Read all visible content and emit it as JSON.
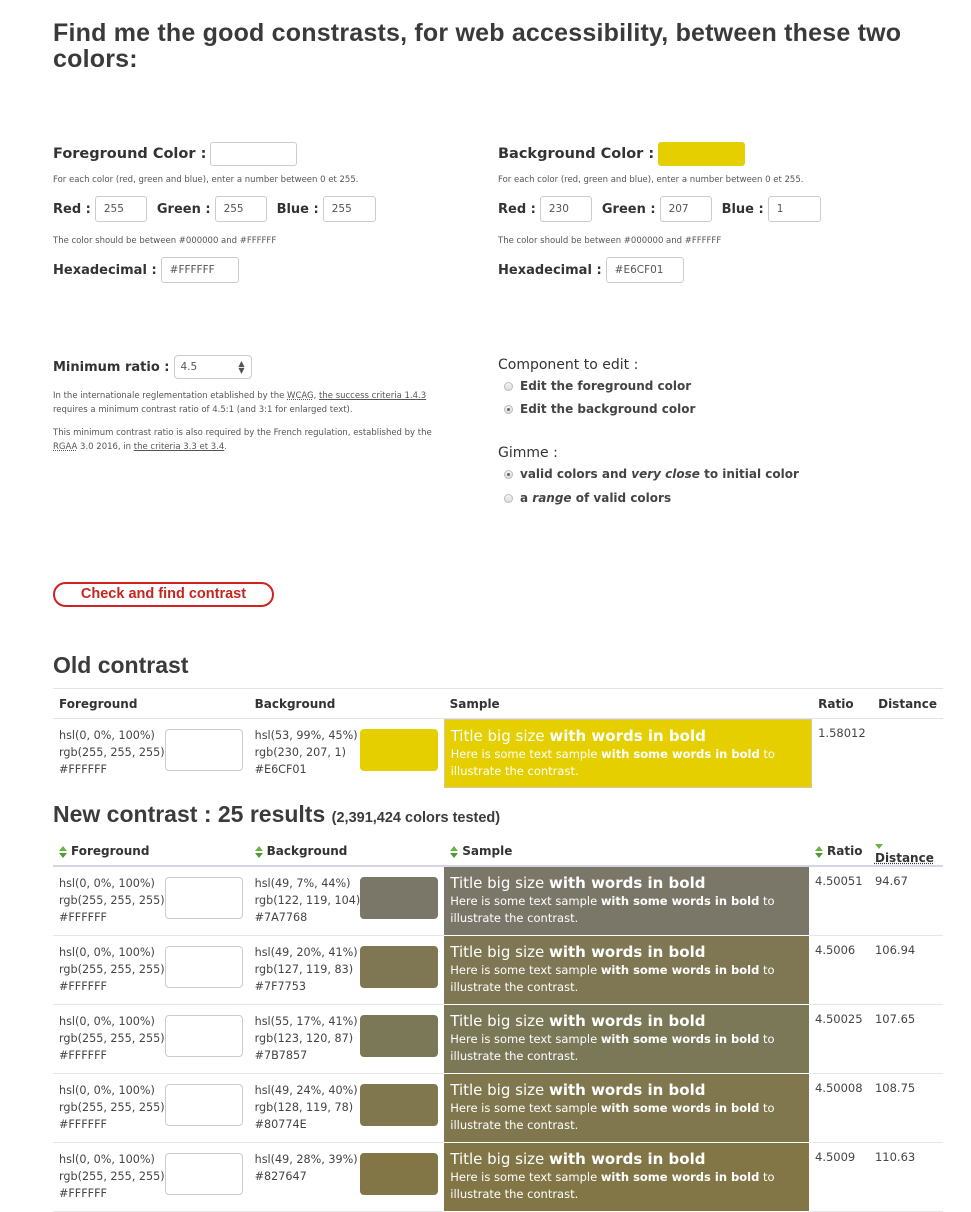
{
  "page": {
    "title": "Find me the good constrasts, for web accessibility, between these two colors:"
  },
  "foreground": {
    "label": "Foreground Color :",
    "preview_color": "#FFFFFF",
    "hint_rgb": "For each color (red, green and blue), enter a number between 0 et 255.",
    "red_label": "Red :",
    "red": "255",
    "green_label": "Green :",
    "green": "255",
    "blue_label": "Blue :",
    "blue": "255",
    "hint_hex": "The color should be between #000000 and #FFFFFF",
    "hex_label": "Hexadecimal :",
    "hex": "#FFFFFF"
  },
  "background": {
    "label": "Background Color :",
    "preview_color": "#E6CF01",
    "hint_rgb": "For each color (red, green and blue), enter a number between 0 et 255.",
    "red_label": "Red :",
    "red": "230",
    "green_label": "Green :",
    "green": "207",
    "blue_label": "Blue :",
    "blue": "1",
    "hint_hex": "The color should be between #000000 and #FFFFFF",
    "hex_label": "Hexadecimal :",
    "hex": "#E6CF01"
  },
  "ratio": {
    "label": "Minimum ratio :",
    "selected": "4.5",
    "para1_a": "In the internationale reglementation etablished by the ",
    "para1_abbr": "WCAG",
    "para1_b": ", ",
    "para1_link": "the success criteria 1.4.3",
    "para1_c": " requires a minimum contrast ratio of 4.5:1 (and 3:1 for enlarged text).",
    "para2_a": "This minimum contrast ratio is also required by the French regulation, established by the ",
    "para2_abbr": "RGAA",
    "para2_b": " 3.0 2016, in ",
    "para2_link": "the criteria 3.3 et 3.4",
    "para2_c": "."
  },
  "component": {
    "heading": "Component to edit :",
    "options": [
      {
        "label": "Edit the foreground color",
        "checked": false
      },
      {
        "label": "Edit the background color",
        "checked": true
      }
    ]
  },
  "gimme": {
    "heading": "Gimme :",
    "opt1_a": "valid colors and ",
    "opt1_em": "very close",
    "opt1_b": " to initial color",
    "opt1_checked": true,
    "opt2_a": "a ",
    "opt2_em": "range",
    "opt2_b": " of valid colors",
    "opt2_checked": false
  },
  "check_button": "Check and find contrast",
  "sample_text": {
    "title_a": "Title big size ",
    "title_b": "with words in bold",
    "body_a": "Here is some text sample ",
    "body_b": "with some words in bold",
    "body_c": " to illustrate the contrast."
  },
  "old_contrast": {
    "heading": "Old contrast",
    "columns": [
      "Foreground",
      "Background",
      "Sample",
      "Ratio",
      "Distance"
    ],
    "row": {
      "fg": {
        "hsl": "hsl(0, 0%, 100%)",
        "rgb": "rgb(255, 255, 255)",
        "hex": "#FFFFFF"
      },
      "bg": {
        "hsl": "hsl(53, 99%, 45%)",
        "rgb": "rgb(230, 207, 1)",
        "hex": "#E6CF01"
      },
      "ratio": "1.58012",
      "distance": ""
    }
  },
  "new_contrast": {
    "heading": "New contrast : 25 results",
    "subheading": "(2,391,424 colors tested)",
    "columns": [
      "Foreground",
      "Background",
      "Sample",
      "Ratio",
      "Distance"
    ],
    "sort_active": "Distance",
    "rows": [
      {
        "fg": {
          "hsl": "hsl(0, 0%, 100%)",
          "rgb": "rgb(255, 255, 255)",
          "hex": "#FFFFFF"
        },
        "bg": {
          "hsl": "hsl(49, 7%, 44%)",
          "rgb": "rgb(122, 119, 104)",
          "hex": "#7A7768"
        },
        "ratio": "4.50051",
        "distance": "94.67"
      },
      {
        "fg": {
          "hsl": "hsl(0, 0%, 100%)",
          "rgb": "rgb(255, 255, 255)",
          "hex": "#FFFFFF"
        },
        "bg": {
          "hsl": "hsl(49, 20%, 41%)",
          "rgb": "rgb(127, 119, 83)",
          "hex": "#7F7753"
        },
        "ratio": "4.5006",
        "distance": "106.94"
      },
      {
        "fg": {
          "hsl": "hsl(0, 0%, 100%)",
          "rgb": "rgb(255, 255, 255)",
          "hex": "#FFFFFF"
        },
        "bg": {
          "hsl": "hsl(55, 17%, 41%)",
          "rgb": "rgb(123, 120, 87)",
          "hex": "#7B7857"
        },
        "ratio": "4.50025",
        "distance": "107.65"
      },
      {
        "fg": {
          "hsl": "hsl(0, 0%, 100%)",
          "rgb": "rgb(255, 255, 255)",
          "hex": "#FFFFFF"
        },
        "bg": {
          "hsl": "hsl(49, 24%, 40%)",
          "rgb": "rgb(128, 119, 78)",
          "hex": "#80774E"
        },
        "ratio": "4.50008",
        "distance": "108.75"
      },
      {
        "fg": {
          "hsl": "hsl(0, 0%, 100%)",
          "rgb": "rgb(255, 255, 255)",
          "hex": "#FFFFFF"
        },
        "bg": {
          "hsl": "hsl(49, 28%, 39%)",
          "rgb": "",
          "hex": "#827647"
        },
        "ratio": "4.5009",
        "distance": "110.63"
      }
    ]
  },
  "colors": {
    "accent_red": "#D0231F",
    "sort_green": "#5BAA3A"
  }
}
